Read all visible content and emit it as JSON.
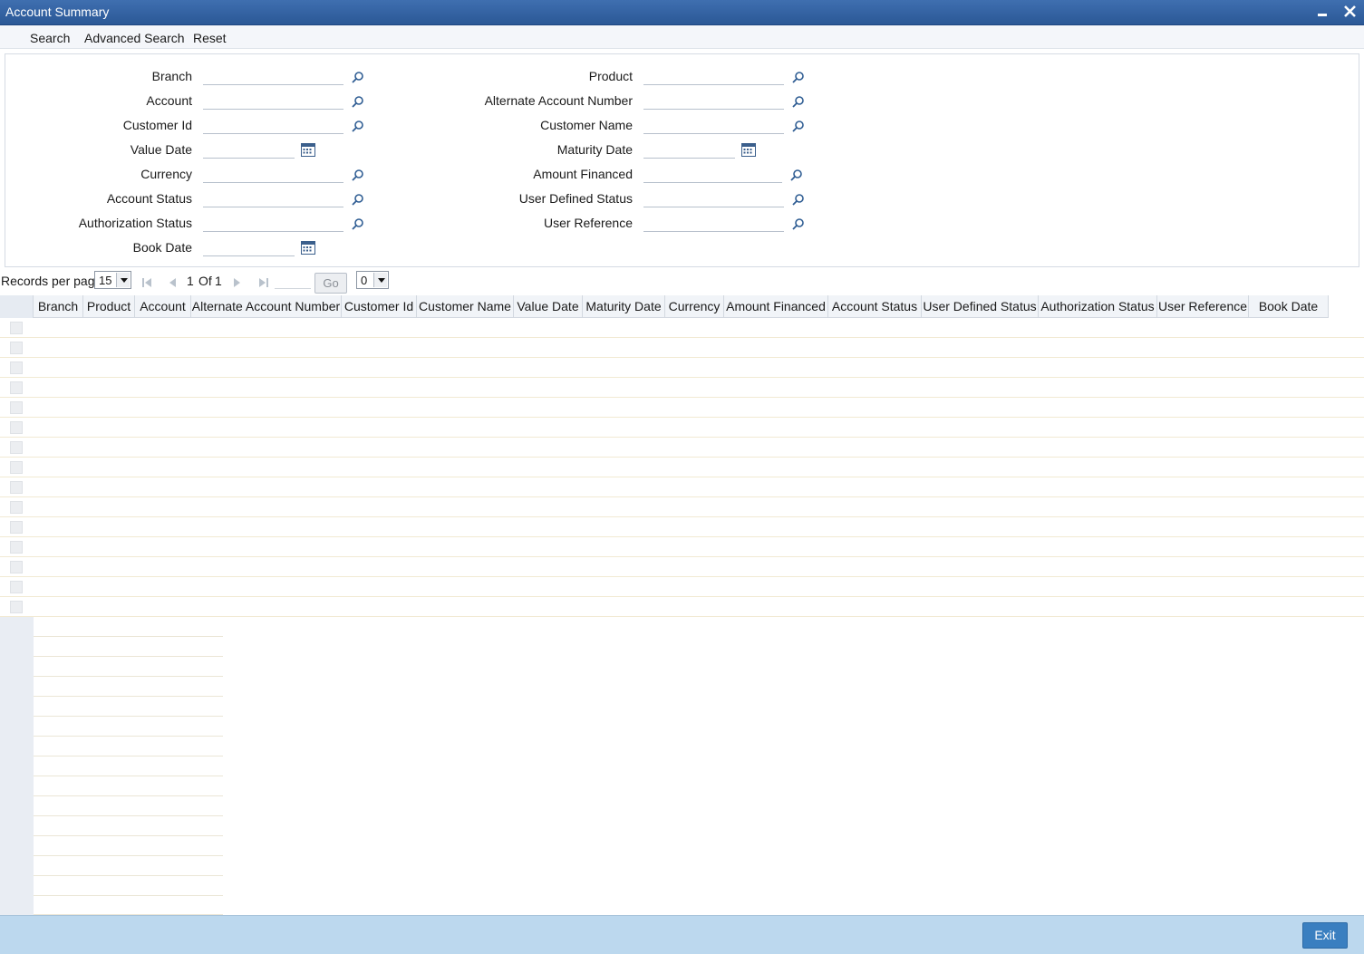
{
  "window": {
    "title": "Account Summary",
    "minimize_icon": "minimize-icon",
    "close_icon": "close-icon"
  },
  "toolbar": {
    "search": "Search",
    "advanced_search": "Advanced Search",
    "reset": "Reset"
  },
  "criteria": {
    "branch": "Branch",
    "account": "Account",
    "customer_id": "Customer Id",
    "value_date": "Value Date",
    "currency": "Currency",
    "account_status": "Account Status",
    "authorization_status": "Authorization Status",
    "book_date": "Book Date",
    "product": "Product",
    "alternate_account_number": "Alternate Account Number",
    "customer_name": "Customer Name",
    "maturity_date": "Maturity Date",
    "amount_financed": "Amount Financed",
    "user_defined_status": "User Defined Status",
    "user_reference": "User Reference"
  },
  "pager": {
    "records_per_page_label": "Records per page",
    "records_per_page_value": "15",
    "page_current": "1",
    "page_of": "Of",
    "page_total": "1",
    "go": "Go",
    "goto_value": "0"
  },
  "grid": {
    "columns": [
      "Branch",
      "Product",
      "Account",
      "Alternate Account Number",
      "Customer Id",
      "Customer Name",
      "Value Date",
      "Maturity Date",
      "Currency",
      "Amount Financed",
      "Account Status",
      "User Defined Status",
      "Authorization Status",
      "User Reference",
      "Book Date"
    ],
    "rows": []
  },
  "footer": {
    "exit": "Exit"
  },
  "colors": {
    "title_bar": "#2b5896",
    "footer": "#bcd8ee",
    "exit_button": "#3a7fc0"
  }
}
